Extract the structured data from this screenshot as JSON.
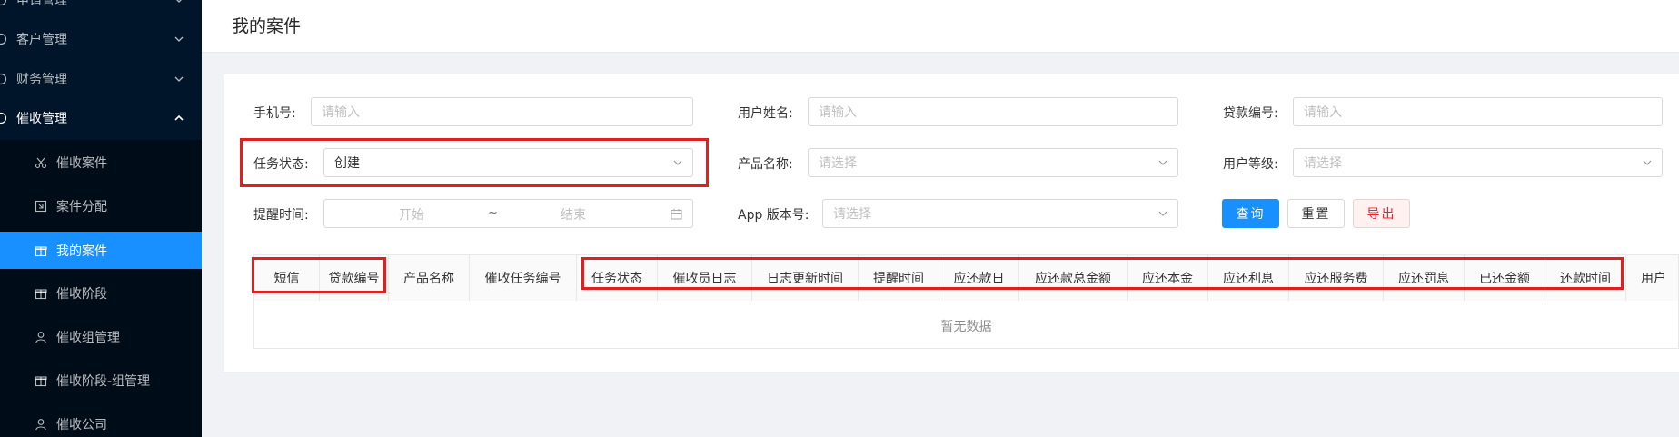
{
  "sidebar": {
    "groups": [
      {
        "label": "申请管理"
      },
      {
        "label": "客户管理"
      },
      {
        "label": "财务管理"
      },
      {
        "label": "催收管理"
      }
    ],
    "items": [
      {
        "label": "催收案件",
        "icon": "scissors-icon"
      },
      {
        "label": "案件分配",
        "icon": "assign-icon"
      },
      {
        "label": "我的案件",
        "icon": "gift-icon"
      },
      {
        "label": "催收阶段",
        "icon": "gift-icon"
      },
      {
        "label": "催收组管理",
        "icon": "user-icon"
      },
      {
        "label": "催收阶段-组管理",
        "icon": "gift-icon"
      },
      {
        "label": "催收公司",
        "icon": "user-icon"
      }
    ]
  },
  "header": {
    "title": "我的案件"
  },
  "filters": {
    "phone": {
      "label": "手机号:",
      "placeholder": "请输入"
    },
    "username": {
      "label": "用户姓名:",
      "placeholder": "请输入"
    },
    "loan_no": {
      "label": "贷款编号:",
      "placeholder": "请输入"
    },
    "task_status": {
      "label": "任务状态:",
      "value": "创建"
    },
    "product_name": {
      "label": "产品名称:",
      "placeholder": "请选择"
    },
    "user_level": {
      "label": "用户等级:",
      "placeholder": "请选择"
    },
    "remind_time": {
      "label": "提醒时间:",
      "start": "开始",
      "sep": "~",
      "end": "结束"
    },
    "app_version": {
      "label": "App 版本号:",
      "placeholder": "请选择"
    }
  },
  "buttons": {
    "query": "查询",
    "reset": "重置",
    "export": "导出"
  },
  "table": {
    "columns": [
      "短信",
      "贷款编号",
      "产品名称",
      "催收任务编号",
      "任务状态",
      "催收员日志",
      "日志更新时间",
      "提醒时间",
      "应还款日",
      "应还款总金额",
      "应还本金",
      "应还利息",
      "应还服务费",
      "应还罚息",
      "已还金额",
      "还款时间",
      "用户"
    ],
    "empty_text": "暂无数据"
  },
  "colors": {
    "primary": "#1890ff",
    "sidebar": "#001529",
    "highlight": "#e02020"
  }
}
